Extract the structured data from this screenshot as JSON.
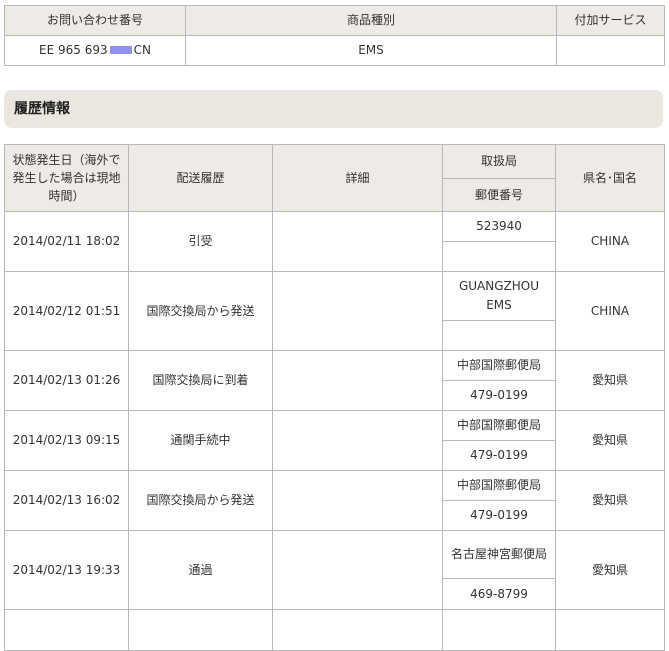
{
  "summary": {
    "headers": {
      "inquiry_number": "お問い合わせ番号",
      "item_type": "商品種別",
      "additional_service": "付加サービス"
    },
    "inquiry_number_prefix": "EE 965 693",
    "inquiry_number_suffix": "CN",
    "item_type": "EMS",
    "additional_service": ""
  },
  "history": {
    "title": "履歴情報",
    "headers": {
      "date": "状態発生日（海外で発生した場合は現地時間）",
      "status": "配送履歴",
      "detail": "詳細",
      "office": "取扱局",
      "zip": "郵便番号",
      "region": "県名･国名"
    },
    "rows": [
      {
        "date": "2014/02/11 18:02",
        "status": "引受",
        "detail": "",
        "office": "523940",
        "zip": "",
        "region": "CHINA"
      },
      {
        "date": "2014/02/12 01:51",
        "status": "国際交換局から発送",
        "detail": "",
        "office": "GUANGZHOU EMS",
        "zip": "",
        "region": "CHINA"
      },
      {
        "date": "2014/02/13 01:26",
        "status": "国際交換局に到着",
        "detail": "",
        "office": "中部国際郵便局",
        "zip": "479-0199",
        "region": "愛知県"
      },
      {
        "date": "2014/02/13 09:15",
        "status": "通関手続中",
        "detail": "",
        "office": "中部国際郵便局",
        "zip": "479-0199",
        "region": "愛知県"
      },
      {
        "date": "2014/02/13 16:02",
        "status": "国際交換局から発送",
        "detail": "",
        "office": "中部国際郵便局",
        "zip": "479-0199",
        "region": "愛知県"
      },
      {
        "date": "2014/02/13 19:33",
        "status": "通過",
        "detail": "",
        "office": "名古屋神宮郵便局",
        "zip": "469-8799",
        "region": "愛知県"
      },
      {
        "date": "",
        "status": "",
        "detail": "",
        "office": "",
        "zip": "",
        "region": ""
      }
    ]
  },
  "colors": {
    "header_bg": "#eeeae5",
    "section_bg": "#ebe6df",
    "border": "#b8b8b8",
    "redaction": "#9090f0"
  }
}
